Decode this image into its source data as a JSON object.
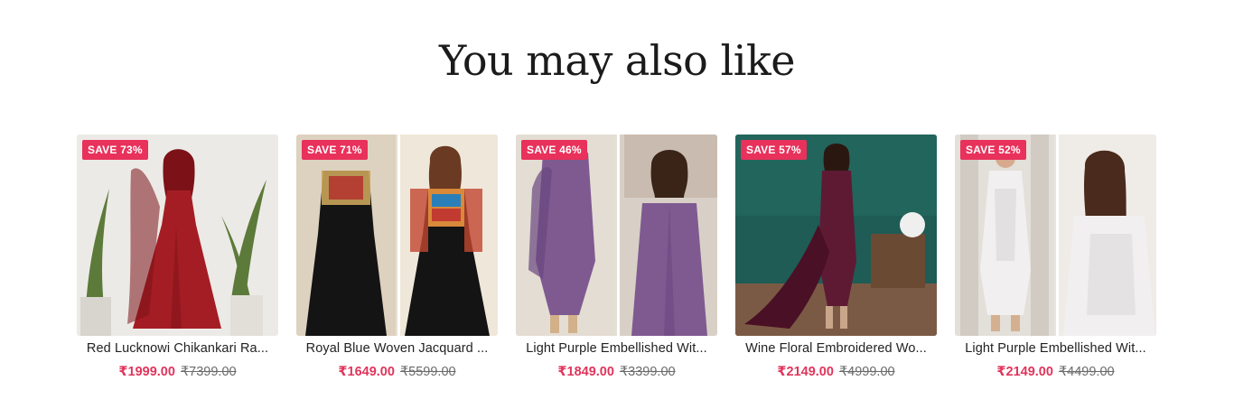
{
  "section": {
    "title": "You may also like"
  },
  "products": [
    {
      "badge": "SAVE 73%",
      "title": "Red Lucknowi Chikankari Ra...",
      "price": "₹1999.00",
      "compare_price": "₹7399.00",
      "colors": {
        "bg": "#eceae6",
        "dress": "#a51d24",
        "dress_dark": "#7c1218",
        "accent": "#5c7a3a",
        "skin": "#d9a583"
      }
    },
    {
      "badge": "SAVE 71%",
      "title": "Royal Blue Woven Jacquard ...",
      "price": "₹1649.00",
      "compare_price": "₹5599.00",
      "colors": {
        "bg": "#e9e0d2",
        "dress": "#141414",
        "dress_dark": "#0a0a0a",
        "accent": "#c9a45a",
        "skin": "#dba889"
      }
    },
    {
      "badge": "SAVE 46%",
      "title": "Light Purple Embellished Wit...",
      "price": "₹1849.00",
      "compare_price": "₹3399.00",
      "colors": {
        "bg": "#e6dfd6",
        "dress": "#7f5a91",
        "dress_dark": "#6a4680",
        "accent": "#b7a8a0",
        "skin": "#e2b498"
      }
    },
    {
      "badge": "SAVE 57%",
      "title": "Wine Floral Embroidered Wo...",
      "price": "₹2149.00",
      "compare_price": "₹4999.00",
      "colors": {
        "bg": "#1e5c55",
        "dress": "#5e1a33",
        "dress_dark": "#4a1025",
        "accent": "#6b4a34",
        "skin": "#d9a383"
      }
    },
    {
      "badge": "SAVE 52%",
      "title": "Light Purple Embellished Wit...",
      "price": "₹2149.00",
      "compare_price": "₹4499.00",
      "colors": {
        "bg": "#e8e4e0",
        "dress": "#f1eff0",
        "dress_dark": "#d9d5d6",
        "accent": "#b9b1a9",
        "skin": "#d8a98d"
      }
    }
  ]
}
